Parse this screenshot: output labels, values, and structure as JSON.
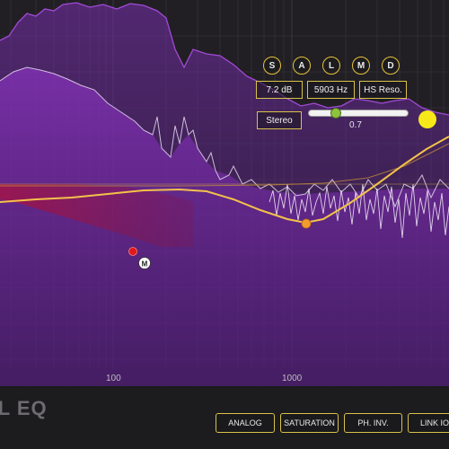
{
  "plugin": {
    "brand": "TAL EQ"
  },
  "axis": {
    "freq_labels": [
      "100",
      "1000"
    ]
  },
  "band_buttons": [
    {
      "label": "S"
    },
    {
      "label": "A"
    },
    {
      "label": "L"
    },
    {
      "label": "M"
    },
    {
      "label": "D"
    }
  ],
  "params": {
    "gain": "7.2 dB",
    "frequency": "5903 Hz",
    "type": "HS Reso.",
    "channel": "Stereo",
    "q_value": "0.7",
    "q_fraction": 0.25
  },
  "markers": {
    "m_label": "M"
  },
  "bottom_buttons": [
    {
      "label": "ANALOG"
    },
    {
      "label": "SATURATION"
    },
    {
      "label": "PH. INV."
    },
    {
      "label": "LINK IO"
    }
  ],
  "colors": {
    "background": "#1c1b1d",
    "curve": "#f3c24a",
    "spectrum_purple": "#7a2fb0",
    "band_handle_yellow": "#f7e81a",
    "band_handle_orange": "#f39a2e",
    "band_handle_red": "#e01a1a",
    "accent_border": "#d8c24a"
  }
}
